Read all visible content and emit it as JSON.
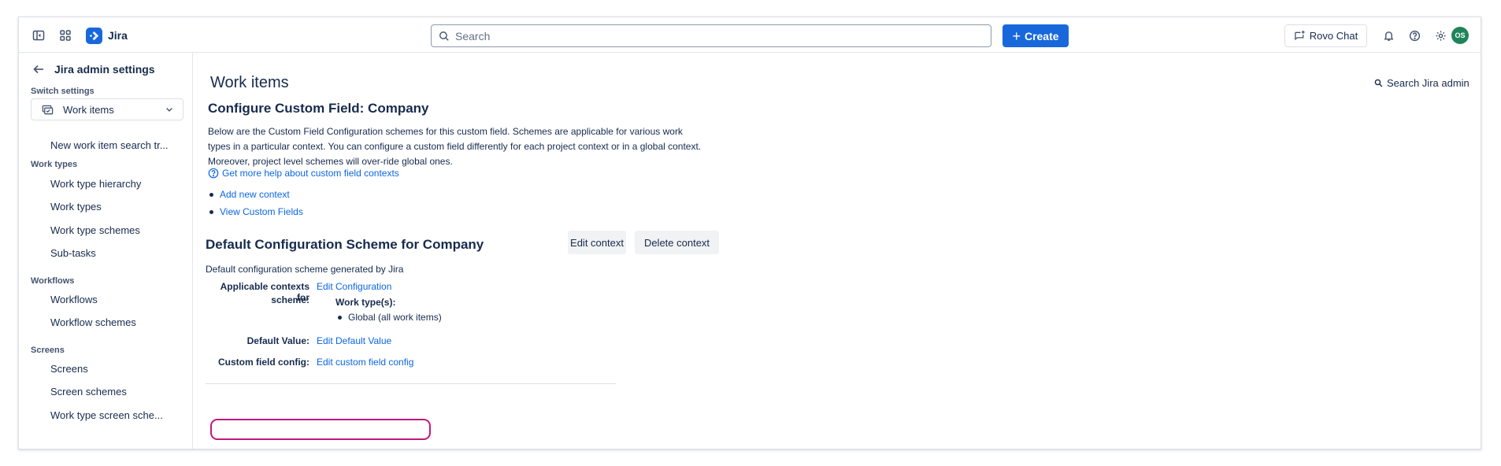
{
  "topbar": {
    "app_name": "Jira",
    "search_placeholder": "Search",
    "create_label": "Create",
    "rovo_label": "Rovo Chat",
    "avatar_initials": "OS",
    "brand_color": "#1868db"
  },
  "sidebar": {
    "title": "Jira admin settings",
    "switch_label": "Switch settings",
    "switch_value": "Work items",
    "top_items": [
      "New work item search tr..."
    ],
    "sections": [
      {
        "label": "Work types",
        "items": [
          "Work type hierarchy",
          "Work types",
          "Work type schemes",
          "Sub-tasks"
        ]
      },
      {
        "label": "Workflows",
        "items": [
          "Workflows",
          "Workflow schemes"
        ]
      },
      {
        "label": "Screens",
        "items": [
          "Screens",
          "Screen schemes",
          "Work type screen sche..."
        ]
      }
    ]
  },
  "main": {
    "page_title": "Work items",
    "search_admin": "Search Jira admin",
    "cf_title": "Configure Custom Field: Company",
    "description": "Below are the Custom Field Configuration schemes for this custom field. Schemes are applicable for various work types in a particular context. You can configure a custom field differently for each project context or in a global context. Moreover, project level schemes will over-ride global ones.",
    "help_link": "Get more help about custom field contexts",
    "links": [
      "Add new context",
      "View Custom Fields"
    ],
    "scheme": {
      "title": "Default Configuration Scheme for Company",
      "edit_context": "Edit context",
      "delete_context": "Delete context",
      "description": "Default configuration scheme generated by Jira",
      "applicable_label_1": "Applicable contexts for",
      "applicable_label_2": "scheme:",
      "edit_configuration": "Edit Configuration",
      "work_types_label": "Work type(s):",
      "work_types": [
        "Global (all work items)"
      ],
      "default_value_label": "Default Value:",
      "edit_default_value": "Edit Default Value",
      "custom_field_config_label": "Custom field config:",
      "edit_custom_field_config": "Edit custom field config"
    },
    "link_color": "#0c66e4",
    "highlight_color": "#c2187a"
  }
}
